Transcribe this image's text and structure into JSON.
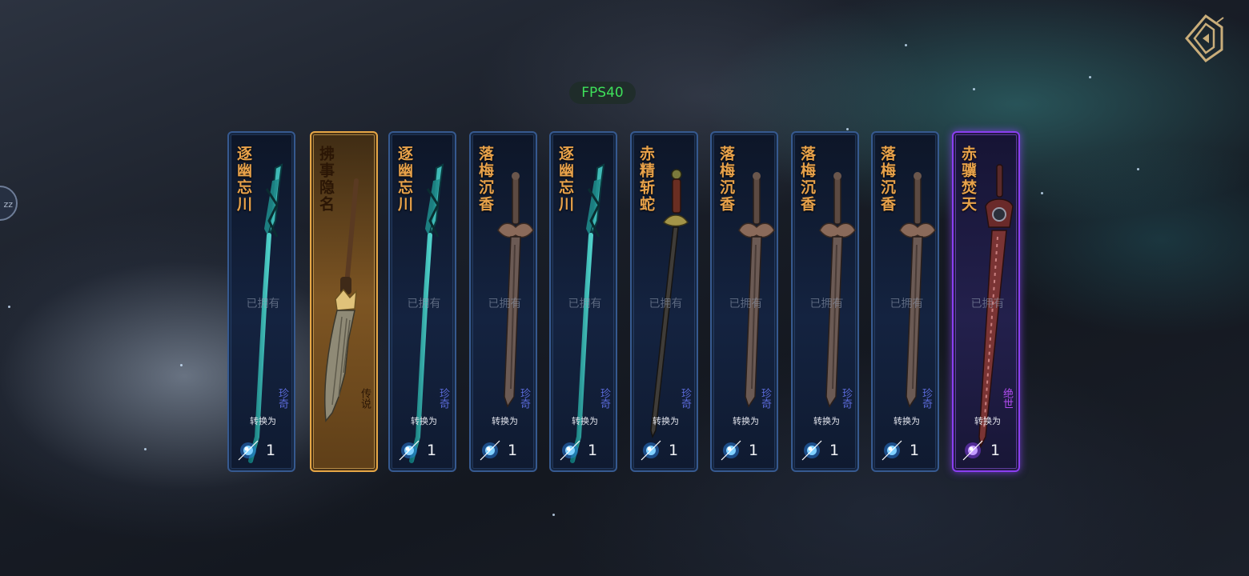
{
  "hud": {
    "fps": "FPS40",
    "side_tab": "zz"
  },
  "cards": [
    {
      "name": "逐幽忘川",
      "owned": "已拥有",
      "rarity": "珍奇",
      "convert": "转换为",
      "qty": "1",
      "frame": "blue",
      "weapon": "teal-spear",
      "currency": "blue-orb-icon"
    },
    {
      "name": "拂事隐名",
      "owned": "",
      "rarity": "传说",
      "convert": "",
      "qty": "",
      "frame": "gold",
      "weapon": "whisk",
      "currency": ""
    },
    {
      "name": "逐幽忘川",
      "owned": "已拥有",
      "rarity": "珍奇",
      "convert": "转换为",
      "qty": "1",
      "frame": "blue",
      "weapon": "teal-spear",
      "currency": "blue-orb-icon"
    },
    {
      "name": "落梅沉香",
      "owned": "已拥有",
      "rarity": "珍奇",
      "convert": "转换为",
      "qty": "1",
      "frame": "blue",
      "weapon": "bronze-sword",
      "currency": "blue-orb-icon"
    },
    {
      "name": "逐幽忘川",
      "owned": "已拥有",
      "rarity": "珍奇",
      "convert": "转换为",
      "qty": "1",
      "frame": "blue",
      "weapon": "teal-spear",
      "currency": "blue-orb-icon"
    },
    {
      "name": "赤精斩蛇",
      "owned": "已拥有",
      "rarity": "珍奇",
      "convert": "转换为",
      "qty": "1",
      "frame": "blue",
      "weapon": "dark-sword",
      "currency": "blue-orb-icon"
    },
    {
      "name": "落梅沉香",
      "owned": "已拥有",
      "rarity": "珍奇",
      "convert": "转换为",
      "qty": "1",
      "frame": "blue",
      "weapon": "bronze-sword",
      "currency": "blue-orb-icon"
    },
    {
      "name": "落梅沉香",
      "owned": "已拥有",
      "rarity": "珍奇",
      "convert": "转换为",
      "qty": "1",
      "frame": "blue",
      "weapon": "bronze-sword",
      "currency": "blue-orb-icon"
    },
    {
      "name": "落梅沉香",
      "owned": "已拥有",
      "rarity": "珍奇",
      "convert": "转换为",
      "qty": "1",
      "frame": "blue",
      "weapon": "bronze-sword",
      "currency": "blue-orb-icon"
    },
    {
      "name": "赤骥焚天",
      "owned": "已拥有",
      "rarity": "绝世",
      "convert": "转换为",
      "qty": "1",
      "frame": "purple",
      "weapon": "red-sword",
      "currency": "purple-orb-icon"
    }
  ],
  "colors": {
    "name": "#e8a24a",
    "fps": "#3ee05a",
    "legend_frame": "#e5a646",
    "peerless_frame": "#8a3ff0",
    "rare_frame": "#36598f"
  }
}
